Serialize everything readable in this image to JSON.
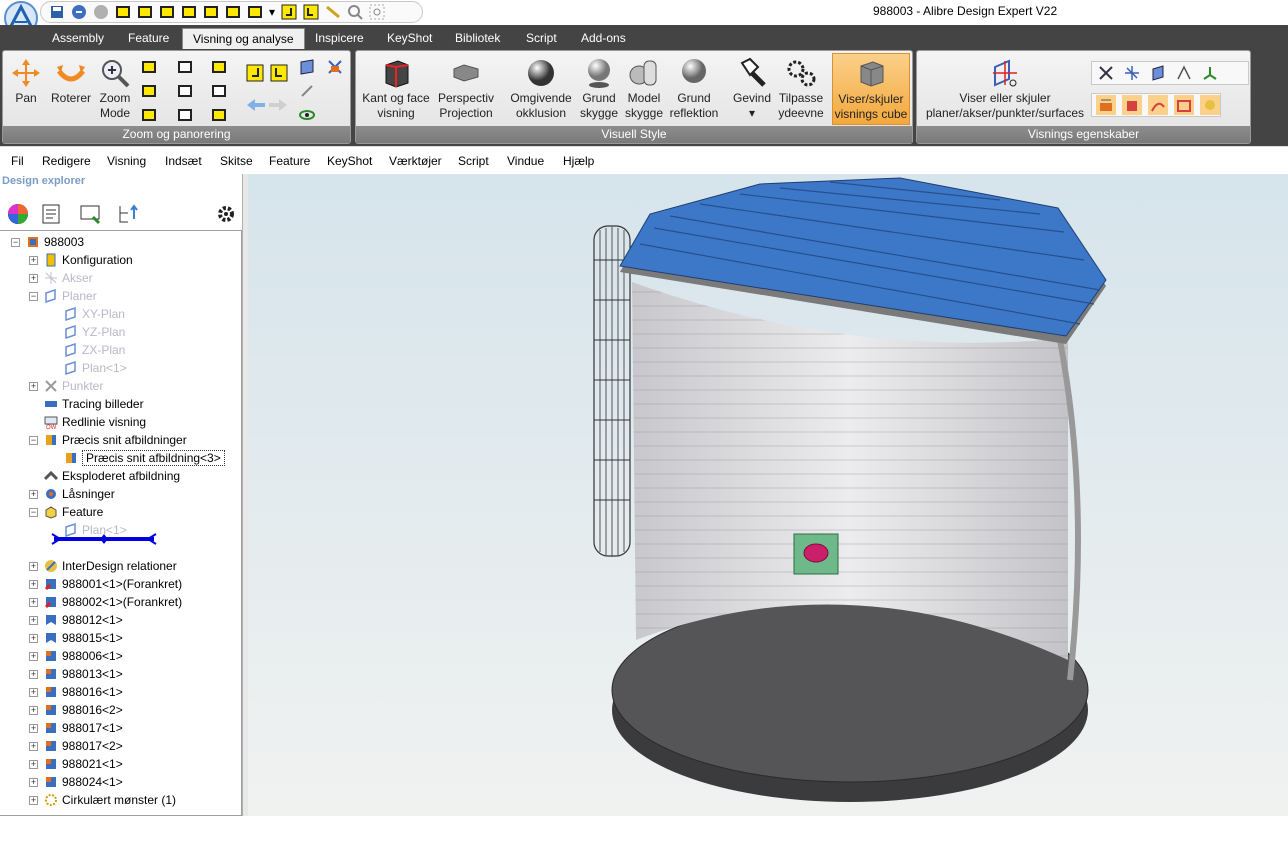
{
  "window": {
    "title": "988003 - Alibre Design Expert V22"
  },
  "tabs": [
    "Assembly",
    "Feature",
    "Visning og analyse",
    "Inspicere",
    "KeyShot",
    "Bibliotek",
    "Script",
    "Add-ons"
  ],
  "active_tab": "Visning og analyse",
  "ribbon": {
    "zoom_group": {
      "label": "Zoom og panorering",
      "pan": "Pan",
      "rotate": "Roterer",
      "zoom_line1": "Zoom",
      "zoom_line2": "Mode"
    },
    "visual_group": {
      "label": "Visuell Style",
      "edge_line1": "Kant og face",
      "edge_line2": "visning",
      "persp_line1": "Perspectiv",
      "persp_line2": "Projection",
      "ao_line1": "Omgivende",
      "ao_line2": "okklusion",
      "ground_shadow_line1": "Grund",
      "ground_shadow_line2": "skygge",
      "model_shadow_line1": "Model",
      "model_shadow_line2": "skygge",
      "ground_refl_line1": "Grund",
      "ground_refl_line2": "reflektion",
      "thread": "Gevind",
      "fit_line1": "Tilpasse",
      "fit_line2": "ydeevne",
      "cube_line1": "Viser/skjuler",
      "cube_line2": "visnings cube"
    },
    "display_group": {
      "label": "Visnings egenskaber",
      "toggle_line1": "Viser eller skjuler",
      "toggle_line2": "planer/akser/punkter/surfaces"
    }
  },
  "menu": [
    "Fil",
    "Redigere",
    "Visning",
    "Indsæt",
    "Skitse",
    "Feature",
    "KeyShot",
    "Værktøjer",
    "Script",
    "Vindue",
    "Hjælp"
  ],
  "explorer": {
    "title": "Design explorer",
    "tree": [
      {
        "label": "988003",
        "level": 0,
        "icon": "assembly",
        "dim": false
      },
      {
        "label": "Konfiguration",
        "level": 1,
        "icon": "config",
        "dim": false
      },
      {
        "label": "Akser",
        "level": 1,
        "icon": "axes",
        "dim": true
      },
      {
        "label": "Planer",
        "level": 1,
        "icon": "plane",
        "dim": true
      },
      {
        "label": "XY-Plan",
        "level": 2,
        "icon": "plane",
        "dim": true
      },
      {
        "label": "YZ-Plan",
        "level": 2,
        "icon": "plane",
        "dim": true
      },
      {
        "label": "ZX-Plan",
        "level": 2,
        "icon": "plane",
        "dim": true
      },
      {
        "label": "Plan<1>",
        "level": 2,
        "icon": "plane",
        "dim": true
      },
      {
        "label": "Punkter",
        "level": 1,
        "icon": "points",
        "dim": true
      },
      {
        "label": "Tracing billeder",
        "level": 1,
        "icon": "tracing",
        "dim": false
      },
      {
        "label": "Redlinie visning",
        "level": 1,
        "icon": "redline",
        "dim": false
      },
      {
        "label": "Præcis snit afbildninger",
        "level": 1,
        "icon": "section",
        "dim": false
      },
      {
        "label": "Præcis snit afbildning<3>",
        "level": 2,
        "icon": "section",
        "dim": false,
        "selected": true
      },
      {
        "label": "Eksploderet afbildning",
        "level": 1,
        "icon": "exploded",
        "dim": false
      },
      {
        "label": "Låsninger",
        "level": 1,
        "icon": "lock",
        "dim": false
      },
      {
        "label": "Feature",
        "level": 1,
        "icon": "feature",
        "dim": false
      },
      {
        "label": "Plan<1>",
        "level": 2,
        "icon": "plane",
        "dim": true
      },
      {
        "label": "InterDesign relationer",
        "level": 1,
        "icon": "interdesign",
        "dim": false
      },
      {
        "label": "988001<1>(Forankret)",
        "level": 1,
        "icon": "part-red",
        "dim": false
      },
      {
        "label": "988002<1>(Forankret)",
        "level": 1,
        "icon": "part-red",
        "dim": false
      },
      {
        "label": "988012<1>",
        "level": 1,
        "icon": "part-blue",
        "dim": false
      },
      {
        "label": "988015<1>",
        "level": 1,
        "icon": "part-blue",
        "dim": false
      },
      {
        "label": "988006<1>",
        "level": 1,
        "icon": "part-orange",
        "dim": false
      },
      {
        "label": "988013<1>",
        "level": 1,
        "icon": "part-orange",
        "dim": false
      },
      {
        "label": "988016<1>",
        "level": 1,
        "icon": "part-orange",
        "dim": false
      },
      {
        "label": "988016<2>",
        "level": 1,
        "icon": "part-orange",
        "dim": false
      },
      {
        "label": "988017<1>",
        "level": 1,
        "icon": "part-orange",
        "dim": false
      },
      {
        "label": "988017<2>",
        "level": 1,
        "icon": "part-orange",
        "dim": false
      },
      {
        "label": "988021<1>",
        "level": 1,
        "icon": "part-orange",
        "dim": false
      },
      {
        "label": "988024<1>",
        "level": 1,
        "icon": "part-orange",
        "dim": false
      },
      {
        "label": "Cirkulært mønster (1)",
        "level": 1,
        "icon": "pattern",
        "dim": false
      }
    ]
  },
  "colors": {
    "ribbon_bg": "#444444",
    "accent_selected": "#f7b24a",
    "roof_blue": "#3d78c8",
    "wall": "#d4d4d6",
    "base": "#4a4a4c"
  }
}
